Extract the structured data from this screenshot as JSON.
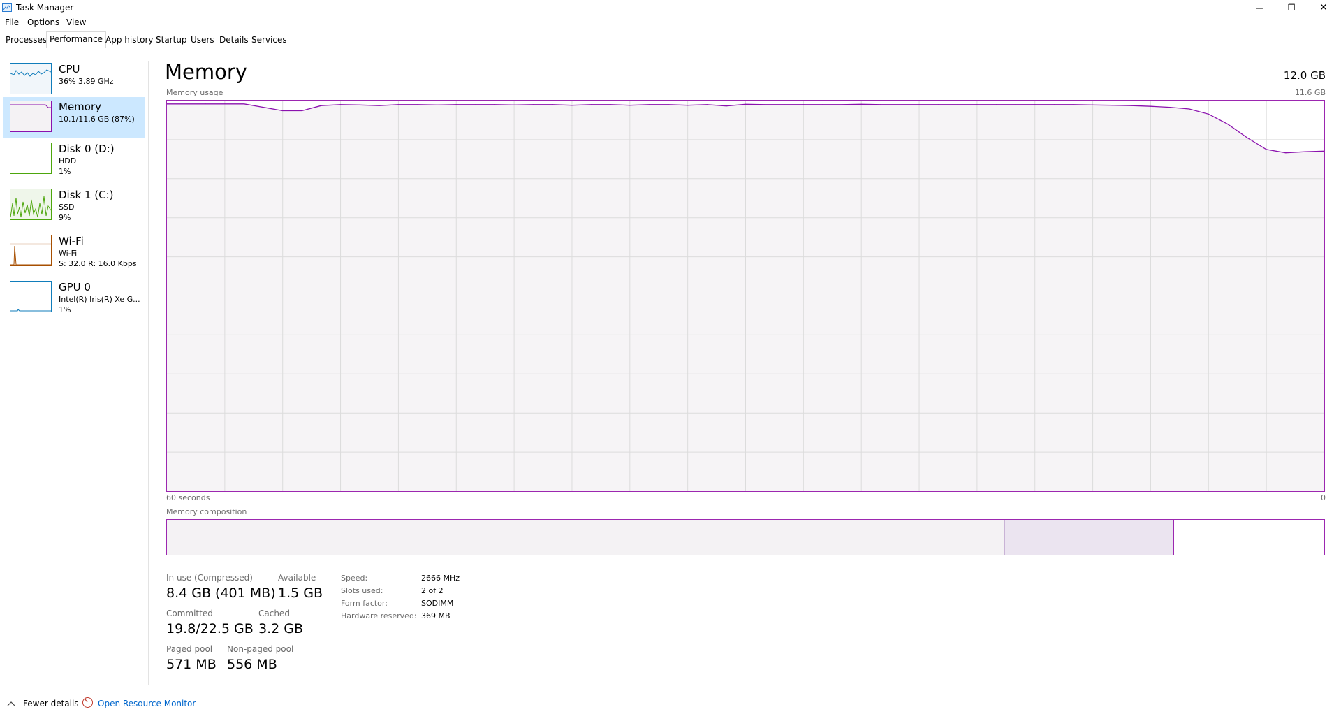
{
  "window": {
    "title": "Task Manager",
    "controls": {
      "minimize": "—",
      "maximize": "❐",
      "close": "✕"
    }
  },
  "menubar": {
    "items": [
      "File",
      "Options",
      "View"
    ]
  },
  "tabs": [
    {
      "label": "Processes",
      "active": false
    },
    {
      "label": "Performance",
      "active": true
    },
    {
      "label": "App history",
      "active": false
    },
    {
      "label": "Startup",
      "active": false
    },
    {
      "label": "Users",
      "active": false
    },
    {
      "label": "Details",
      "active": false
    },
    {
      "label": "Services",
      "active": false
    }
  ],
  "sidebar": {
    "items": [
      {
        "name": "CPU",
        "sub1": "36%  3.89 GHz",
        "sub2": "",
        "sub3": "",
        "color": "#117dbb",
        "active": false
      },
      {
        "name": "Memory",
        "sub1": "10.1/11.6 GB (87%)",
        "sub2": "",
        "sub3": "",
        "color": "#8b12ae",
        "active": true
      },
      {
        "name": "Disk 0 (D:)",
        "sub1": "HDD",
        "sub2": "1%",
        "sub3": "",
        "color": "#4da60c",
        "active": false
      },
      {
        "name": "Disk 1 (C:)",
        "sub1": "SSD",
        "sub2": "9%",
        "sub3": "",
        "color": "#4da60c",
        "active": false
      },
      {
        "name": "Wi-Fi",
        "sub1": "Wi-Fi",
        "sub2": "S: 32.0  R: 16.0 Kbps",
        "sub3": "",
        "color": "#a74f01",
        "active": false
      },
      {
        "name": "GPU 0",
        "sub1": "Intel(R) Iris(R) Xe G...",
        "sub2": "1%",
        "sub3": "",
        "color": "#117dbb",
        "active": false
      }
    ]
  },
  "main": {
    "title": "Memory",
    "total": "12.0 GB",
    "usage_label": "Memory usage",
    "usage_max": "11.6 GB",
    "time_left": "60 seconds",
    "time_right": "0",
    "composition_label": "Memory composition",
    "colors": {
      "line": "#8b12ae",
      "fill": "#f4f2f4",
      "grid": "#dcdcdc",
      "border": "#9c27b0"
    }
  },
  "chart_data": {
    "type": "line",
    "title": "Memory usage",
    "xlabel": "60 seconds",
    "ylabel": "",
    "ylim": [
      0,
      11.6
    ],
    "x": [
      60,
      59,
      58,
      57,
      56,
      55,
      54,
      53,
      52,
      51,
      50,
      49,
      48,
      47,
      46,
      45,
      44,
      43,
      42,
      41,
      40,
      39,
      38,
      37,
      36,
      35,
      34,
      33,
      32,
      31,
      30,
      29,
      28,
      27,
      26,
      25,
      24,
      23,
      22,
      21,
      20,
      19,
      18,
      17,
      16,
      15,
      14,
      13,
      12,
      11,
      10,
      9,
      8,
      7,
      6,
      5,
      4,
      3,
      2,
      1,
      0
    ],
    "series": [
      {
        "values": [
          11.5,
          11.5,
          11.5,
          11.5,
          11.5,
          11.4,
          11.3,
          11.3,
          11.45,
          11.48,
          11.47,
          11.45,
          11.48,
          11.48,
          11.47,
          11.48,
          11.48,
          11.48,
          11.47,
          11.48,
          11.48,
          11.46,
          11.48,
          11.48,
          11.46,
          11.48,
          11.48,
          11.46,
          11.48,
          11.44,
          11.49,
          11.48,
          11.48,
          11.48,
          11.48,
          11.48,
          11.49,
          11.48,
          11.48,
          11.48,
          11.48,
          11.48,
          11.48,
          11.48,
          11.48,
          11.48,
          11.48,
          11.48,
          11.47,
          11.46,
          11.45,
          11.43,
          11.4,
          11.35,
          11.2,
          10.9,
          10.5,
          10.15,
          10.05,
          10.08,
          10.1
        ]
      }
    ],
    "grid": true
  },
  "composition": {
    "segments": [
      {
        "name": "In use",
        "fraction": 0.7245,
        "color": "#f4f2f4"
      },
      {
        "name": "Standby",
        "fraction": 0.1455,
        "color": "#ebe4f0"
      },
      {
        "name": "Free",
        "fraction": 0.13,
        "color": "#ffffff"
      }
    ]
  },
  "stats": {
    "in_use_label": "In use (Compressed)",
    "in_use_value": "8.4 GB (401 MB)",
    "available_label": "Available",
    "available_value": "1.5 GB",
    "committed_label": "Committed",
    "committed_value": "19.8/22.5 GB",
    "cached_label": "Cached",
    "cached_value": "3.2 GB",
    "paged_label": "Paged pool",
    "paged_value": "571 MB",
    "nonpaged_label": "Non-paged pool",
    "nonpaged_value": "556 MB"
  },
  "details": [
    {
      "label": "Speed:",
      "value": "2666 MHz"
    },
    {
      "label": "Slots used:",
      "value": "2 of 2"
    },
    {
      "label": "Form factor:",
      "value": "SODIMM"
    },
    {
      "label": "Hardware reserved:",
      "value": "369 MB"
    }
  ],
  "footer": {
    "fewer_details": "Fewer details",
    "resource_monitor": "Open Resource Monitor"
  }
}
